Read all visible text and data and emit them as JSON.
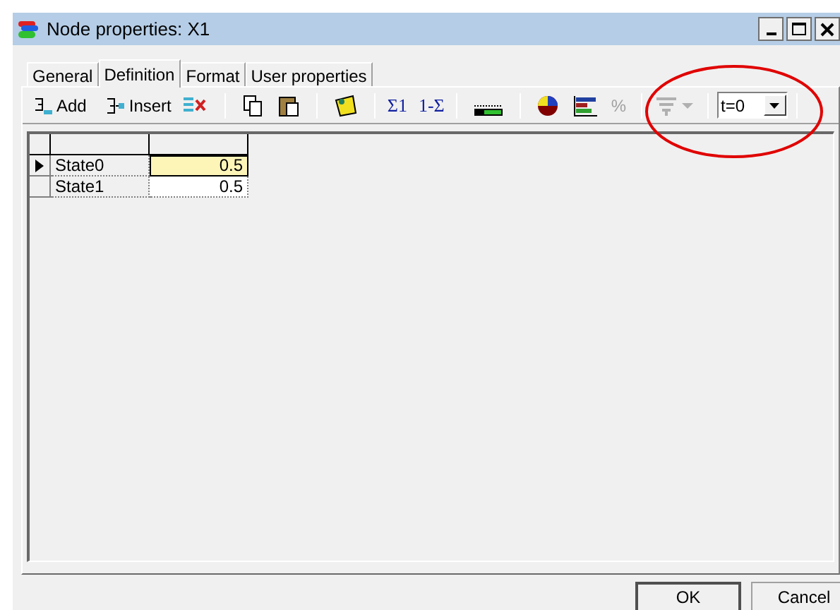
{
  "window": {
    "title": "Node properties: X1"
  },
  "tabs": [
    {
      "label": "General",
      "selected": false
    },
    {
      "label": "Definition",
      "selected": true
    },
    {
      "label": "Format",
      "selected": false
    },
    {
      "label": "User properties",
      "selected": false
    }
  ],
  "toolbar": {
    "add": "Add",
    "insert": "Insert",
    "normalize": "Σ1",
    "complement": "1-Σ",
    "percent": {
      "label": "%",
      "disabled": true
    },
    "filter": {
      "disabled": true
    },
    "time_select": {
      "value": "t=0"
    }
  },
  "table": {
    "rows": [
      {
        "name": "State0",
        "value": "0.5",
        "selected": true
      },
      {
        "name": "State1",
        "value": "0.5",
        "selected": false
      }
    ]
  },
  "buttons": [
    {
      "label": "OK"
    },
    {
      "label": "Cancel"
    }
  ]
}
